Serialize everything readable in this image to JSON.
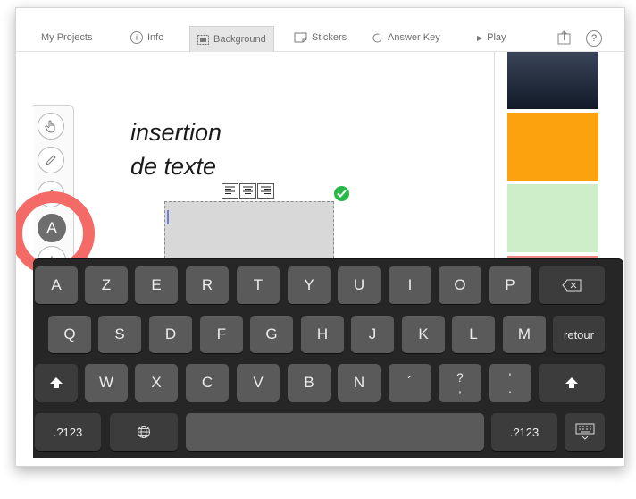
{
  "toolbar": {
    "tabs": [
      {
        "label": "My Projects",
        "icon": "none"
      },
      {
        "label": "Info",
        "icon": "info-icon",
        "icon_glyph": "i"
      },
      {
        "label": "Background",
        "icon": "background-icon"
      },
      {
        "label": "Stickers",
        "icon": "stickers-icon"
      },
      {
        "label": "Answer Key",
        "icon": "answer-key-icon"
      },
      {
        "label": "Play",
        "icon": "play-icon",
        "icon_glyph": "▶"
      }
    ],
    "active_tab": "Background",
    "help_glyph": "?",
    "export_icon": "share-icon"
  },
  "tools": {
    "items": [
      "hand-icon",
      "pencil-icon",
      "eraser-icon",
      "text-tool-icon",
      "add-icon"
    ],
    "text_tool_glyph": "A",
    "add_glyph": "+",
    "selected": "text-tool-icon",
    "highlight_color": "#f36a67"
  },
  "canvas": {
    "text_line1": "insertion",
    "text_line2": "de texte",
    "align_icons": [
      "align-left-icon",
      "align-center-icon",
      "align-right-icon"
    ],
    "confirm_icon": "checkmark-icon",
    "confirm_color": "#27b84a"
  },
  "backgrounds": {
    "colors": [
      "#1f2a3d",
      "#fca20f",
      "#cdeec8",
      "#f08a8a"
    ]
  },
  "keyboard": {
    "row1": [
      "A",
      "Z",
      "E",
      "R",
      "T",
      "Y",
      "U",
      "I",
      "O",
      "P"
    ],
    "row2": [
      "Q",
      "S",
      "D",
      "F",
      "G",
      "H",
      "J",
      "K",
      "L",
      "M"
    ],
    "row3": [
      "W",
      "X",
      "C",
      "V",
      "B",
      "N"
    ],
    "row3_punct": [
      "´",
      "?",
      ",",
      "'",
      "."
    ],
    "return_label": "retour",
    "numbers_label": ".?123",
    "delete_icon": "delete-key-icon",
    "shift_icon": "shift-icon",
    "globe_icon": "globe-icon",
    "hide_icon": "keyboard-hide-icon"
  }
}
